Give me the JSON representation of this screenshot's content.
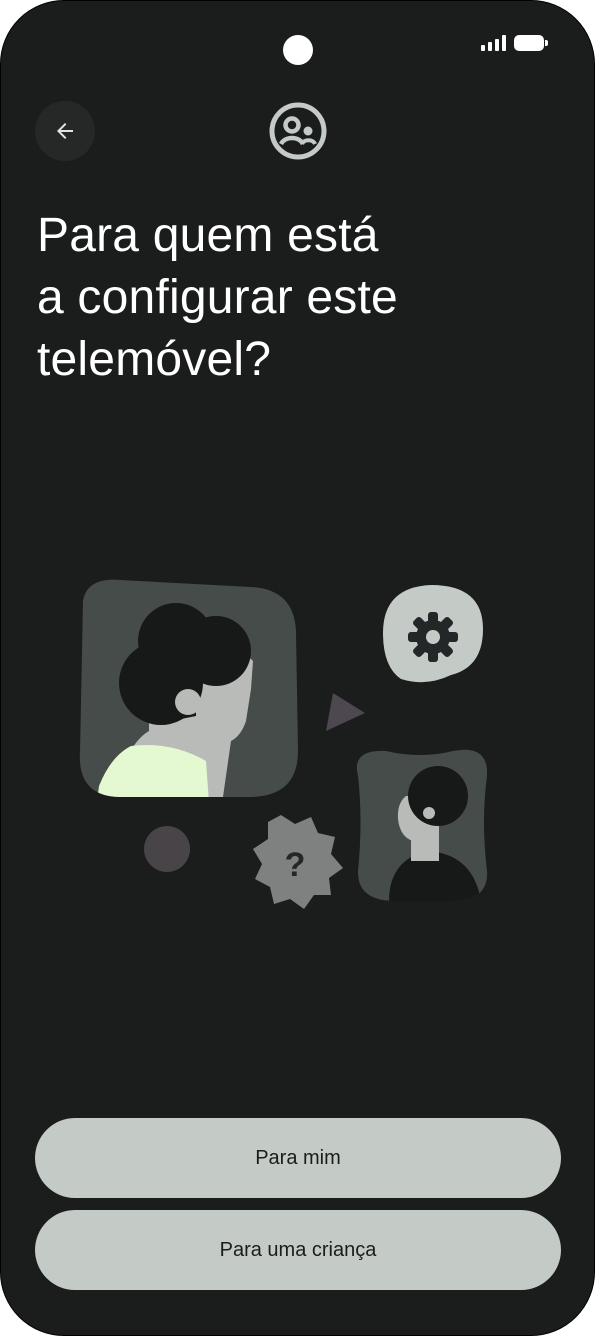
{
  "status_bar": {
    "signal_icon": "signal-icon",
    "battery_icon": "battery-icon"
  },
  "header": {
    "back_icon": "arrow-back-icon",
    "app_icon": "supervised-user-icon"
  },
  "title": {
    "line1": "Para quem está",
    "line2": "a configurar este",
    "line3": "telemóvel?"
  },
  "illustration": {
    "elements": [
      "adult-avatar",
      "child-avatar",
      "settings-gear-icon",
      "question-badge-icon",
      "play-triangle",
      "decorative-dot"
    ],
    "colors": {
      "background": "#1b1c1c",
      "frame": "#454c4a",
      "skin": "#b9bbb9",
      "hair": "#171919",
      "shirt": "#e4f8d2",
      "badge": "#c4cbc6",
      "question": "#7f8180",
      "dot": "#484448",
      "triangle": "#4d4750"
    }
  },
  "buttons": {
    "for_me": "Para mim",
    "for_child": "Para uma criança"
  },
  "colors": {
    "screen_background": "#1b1c1c",
    "button_background": "#c4cbc6",
    "button_text": "#1b1c1c",
    "title_text": "#ffffff"
  }
}
